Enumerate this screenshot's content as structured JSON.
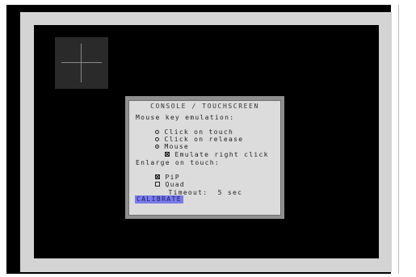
{
  "dialog": {
    "title": "CONSOLE / TOUCHSCREEN",
    "mouse_key_heading": "Mouse key emulation:",
    "options": [
      {
        "label": "Click on touch",
        "selected": false
      },
      {
        "label": "Click on release",
        "selected": false
      },
      {
        "label": "Mouse",
        "selected": true
      }
    ],
    "emulate_right_click": {
      "label": "Emulate right click",
      "checked": true
    },
    "enlarge_heading": "Enlarge on touch:",
    "pip": {
      "label": "PiP",
      "checked": true
    },
    "quad": {
      "label": "Quad",
      "checked": false
    },
    "timeout_label": "Timeout:",
    "timeout_value": "5 sec",
    "calibrate_label": "CALIBRATE"
  },
  "colors": {
    "bezel": "#d4d4d4",
    "screen": "#000000",
    "dialog_bg": "#dcdcdc",
    "calibrate_bg": "#7a7ae8"
  }
}
